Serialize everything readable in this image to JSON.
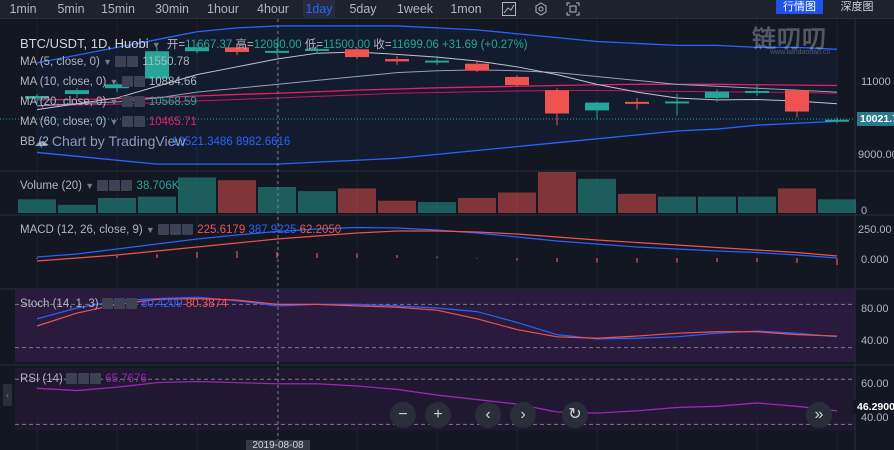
{
  "toolbar": {
    "timeframes": [
      "1min",
      "5min",
      "15min",
      "30min",
      "1hour",
      "4hour",
      "1day",
      "5day",
      "1week",
      "1mon"
    ],
    "active": "1day",
    "icons": [
      "chart-line-icon",
      "settings-icon",
      "fullscreen-icon"
    ],
    "right_buttons": [
      "行情图",
      "深度图"
    ]
  },
  "symbol": {
    "title": "BTC/USDT, 1D, Huobi",
    "open_label": "开=",
    "open": "11667.37",
    "high_label": "高=",
    "high": "12080.00",
    "low_label": "低=",
    "low": "11500.00",
    "close_label": "收=",
    "close": "11699.06",
    "change": "+31.69 (+0.27%)"
  },
  "indicators": {
    "ma5": {
      "label": "MA (5, close, 0)",
      "value": "11550.78",
      "color": "#b2b5be"
    },
    "ma10": {
      "label": "MA (10, close, 0)",
      "value": "10884.66",
      "color": "#b2b5be"
    },
    "ma20": {
      "label": "MA (20, close, 0)",
      "value": "10568.59",
      "color": "#b2b5be"
    },
    "ma60": {
      "label": "MA (60, close, 0)",
      "value": "10465.71",
      "color": "#e91e63"
    },
    "bb": {
      "label": "BB (2",
      "value1": "10521.3486",
      "value2": "8982.6616",
      "color": "#2962ff"
    },
    "volume": {
      "label": "Volume (20)",
      "value": "38.706K",
      "color": "#26a69a"
    },
    "macd": {
      "label": "MACD (12, 26, close, 9)",
      "value1": "225.6179",
      "value2": "387.9225",
      "value3": "62.2050"
    },
    "stoch": {
      "label": "Stoch (14, 1, 3)",
      "value1": "80.4209",
      "value2": "80.3874"
    },
    "rsi": {
      "label": "RSI (14)",
      "value": "65.7676"
    }
  },
  "price_axis": {
    "main": [
      "11000",
      "10000",
      "9000.00"
    ],
    "volume": [
      "0"
    ],
    "macd": [
      "250.00",
      "0.000"
    ],
    "stoch": [
      "80.00",
      "40.00"
    ],
    "rsi": [
      "60.00",
      "40.00"
    ],
    "current_price": "10021.7",
    "rsi_current": "46.2900"
  },
  "date_tag": "2019-08-08",
  "tv_logo": "Chart by TradingView",
  "watermark": "链叨叨",
  "watermark_url": "www.liandaodao.cn",
  "controls": [
    "−",
    "+",
    "‹",
    "›",
    "↻",
    "»"
  ],
  "colors": {
    "up": "#26a69a",
    "down": "#ef5350",
    "bg": "#131722"
  },
  "chart_data": {
    "type": "candlestick",
    "candles": [
      {
        "o": 10580,
        "c": 10650,
        "h": 10700,
        "l": 10450
      },
      {
        "o": 10700,
        "c": 10800,
        "h": 10850,
        "l": 10600
      },
      {
        "o": 10850,
        "c": 10950,
        "h": 11000,
        "l": 10750
      },
      {
        "o": 11100,
        "c": 11800,
        "h": 11900,
        "l": 11050
      },
      {
        "o": 11800,
        "c": 11900,
        "h": 12000,
        "l": 11750
      },
      {
        "o": 11900,
        "c": 11780,
        "h": 12010,
        "l": 11700
      },
      {
        "o": 11780,
        "c": 11810,
        "h": 12000,
        "l": 11700
      },
      {
        "o": 11810,
        "c": 11860,
        "h": 11950,
        "l": 11750
      },
      {
        "o": 11850,
        "c": 11650,
        "h": 11900,
        "l": 11600
      },
      {
        "o": 11600,
        "c": 11540,
        "h": 11680,
        "l": 11450
      },
      {
        "o": 11530,
        "c": 11560,
        "h": 11680,
        "l": 11450
      },
      {
        "o": 11480,
        "c": 11300,
        "h": 11530,
        "l": 11270
      },
      {
        "o": 11140,
        "c": 10930,
        "h": 11180,
        "l": 10880
      },
      {
        "o": 10800,
        "c": 10200,
        "h": 10850,
        "l": 9900
      },
      {
        "o": 10280,
        "c": 10480,
        "h": 10500,
        "l": 10050
      },
      {
        "o": 10500,
        "c": 10460,
        "h": 10600,
        "l": 10300
      },
      {
        "o": 10470,
        "c": 10510,
        "h": 10700,
        "l": 10150
      },
      {
        "o": 10600,
        "c": 10760,
        "h": 10820,
        "l": 10500
      },
      {
        "o": 10750,
        "c": 10780,
        "h": 10950,
        "l": 10650
      },
      {
        "o": 10800,
        "c": 10250,
        "h": 10820,
        "l": 10100
      },
      {
        "o": 10020,
        "c": 10040,
        "h": 10100,
        "l": 9950
      }
    ],
    "volume": [
      10,
      6,
      11,
      12,
      26,
      24,
      19,
      16,
      18,
      9,
      8,
      11,
      15,
      30,
      25,
      14,
      12,
      12,
      12,
      18,
      10
    ],
    "macd_hist": [
      -10,
      5,
      20,
      40,
      60,
      70,
      60,
      50,
      45,
      30,
      15,
      -5,
      -25,
      -40,
      -45,
      -45,
      -45,
      -40,
      -40,
      -50,
      -70
    ],
    "macd_line": [
      10,
      40,
      90,
      140,
      190,
      230,
      265,
      290,
      305,
      300,
      280,
      250,
      210,
      170,
      140,
      110,
      90,
      70,
      55,
      30,
      0
    ],
    "signal_line": [
      -30,
      0,
      30,
      70,
      110,
      150,
      190,
      220,
      250,
      270,
      270,
      260,
      240,
      210,
      180,
      155,
      130,
      105,
      80,
      55,
      20
    ],
    "stoch_k": [
      60,
      75,
      85,
      88,
      90,
      85,
      78,
      80,
      80,
      78,
      75,
      70,
      55,
      38,
      32,
      33,
      35,
      40,
      43,
      40,
      35
    ],
    "stoch_d": [
      50,
      68,
      80,
      87,
      88,
      86,
      80,
      80,
      78,
      76,
      72,
      60,
      45,
      35,
      33,
      36,
      40,
      42,
      42,
      38,
      36
    ],
    "rsi": [
      62,
      60,
      63,
      67,
      68,
      67,
      66,
      66,
      64,
      61,
      56,
      52,
      48,
      41,
      40,
      42,
      45,
      46,
      49,
      46,
      42
    ],
    "ma5": [
      10300,
      10450,
      10600,
      10900,
      11200,
      11400,
      11600,
      11750,
      11780,
      11720,
      11650,
      11550,
      11400,
      11200,
      10950,
      10750,
      10600,
      10550,
      10560,
      10520,
      10450
    ],
    "ma10": [
      10400,
      10450,
      10500,
      10600,
      10750,
      10850,
      10950,
      11050,
      11150,
      11250,
      11300,
      11320,
      11300,
      11250,
      11150,
      11050,
      10950,
      10900,
      10850,
      10800,
      10750
    ],
    "ma20": [
      10400,
      10420,
      10440,
      10480,
      10520,
      10560,
      10600,
      10640,
      10680,
      10720,
      10740,
      10760,
      10780,
      10790,
      10790,
      10780,
      10770,
      10760,
      10750,
      10740,
      10720
    ],
    "ma60": [
      10550,
      10560,
      10580,
      10610,
      10650,
      10690,
      10720,
      10760,
      10800,
      10830,
      10860,
      10880,
      10900,
      10920,
      10940,
      10950,
      10950,
      10950,
      10940,
      10930,
      10920
    ],
    "bb_upper": [
      11500,
      11700,
      11900,
      12100,
      12300,
      12400,
      12450,
      12450,
      12450,
      12450,
      12400,
      12350,
      12250,
      12150,
      12050,
      12000,
      11950,
      11950,
      11900,
      11900,
      11850
    ],
    "bb_lower": [
      9200,
      9100,
      9000,
      8900,
      8900,
      8900,
      8900,
      8950,
      9000,
      9050,
      9150,
      9250,
      9350,
      9450,
      9550,
      9650,
      9750,
      9800,
      9900,
      9950,
      10000
    ]
  }
}
